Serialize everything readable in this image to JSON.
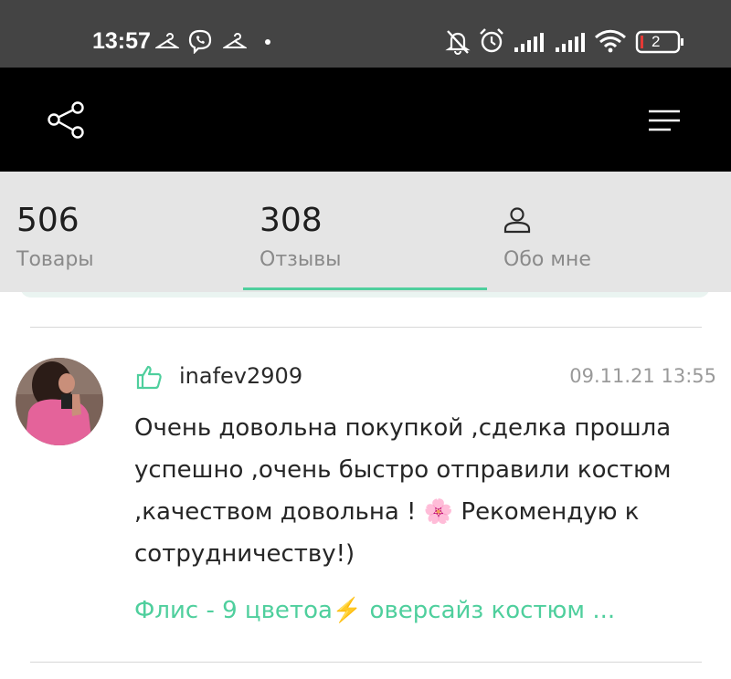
{
  "status_bar": {
    "time": "13:57",
    "battery_level": "2"
  },
  "app_bar": {
    "left_icon": "share-icon",
    "right_icon": "menu-icon"
  },
  "stats": {
    "products_count": "506",
    "products_label": "Товары",
    "reviews_count": "308",
    "reviews_label": "Отзывы",
    "about_label": "Обо мне",
    "about_icon": "user-icon"
  },
  "review": {
    "author": "inafev2909",
    "date": "09.11.21 13:55",
    "text": "Очень довольна покупкой ,сделка прошла успешно ,очень быстро отправили костюм ,качеством довольна ! 🌸 Рекомендую к сотрудничеству!)",
    "product": "Флис - 9 цветоа⚡️ оверсайз костюм ...",
    "rating_icon": "thumbs-up-icon"
  },
  "colors": {
    "accent": "#4fcf9d",
    "status_bar_bg": "#444444",
    "app_bar_bg": "#000000",
    "stats_bg": "#e5e5e5"
  }
}
